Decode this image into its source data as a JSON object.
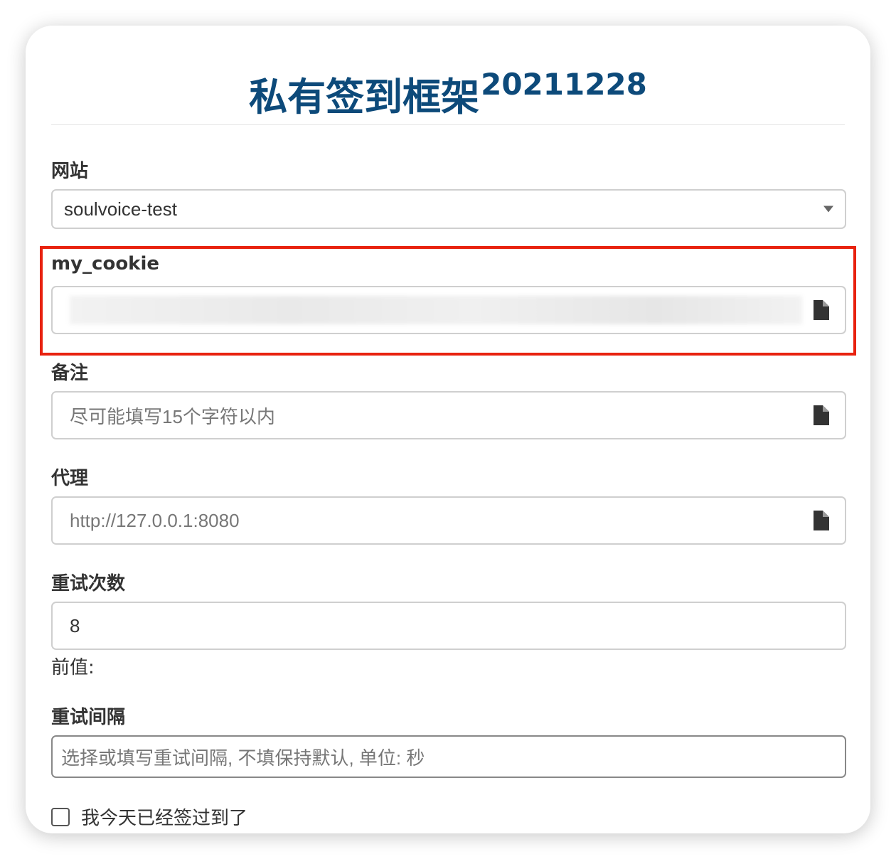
{
  "header": {
    "title": "私有签到框架",
    "version": "20211228"
  },
  "form": {
    "site": {
      "label": "网站",
      "value": "soulvoice-test"
    },
    "cookie": {
      "label": "my_cookie",
      "value_note": "blurred"
    },
    "note": {
      "label": "备注",
      "placeholder": "尽可能填写15个字符以内"
    },
    "proxy": {
      "label": "代理",
      "placeholder": "http://127.0.0.1:8080"
    },
    "retry_count": {
      "label": "重试次数",
      "value": "8",
      "current_value_label": "前值:"
    },
    "retry_interval": {
      "label": "重试间隔",
      "placeholder": "选择或填写重试间隔, 不填保持默认, 单位: 秒"
    },
    "checked_today": {
      "label": "我今天已经签过到了",
      "checked": false
    }
  },
  "colors": {
    "title": "#0d4a7a",
    "highlight_border": "#e8220f"
  },
  "icons": {
    "select_arrow": "chevron-down-icon",
    "file": "document-icon"
  }
}
